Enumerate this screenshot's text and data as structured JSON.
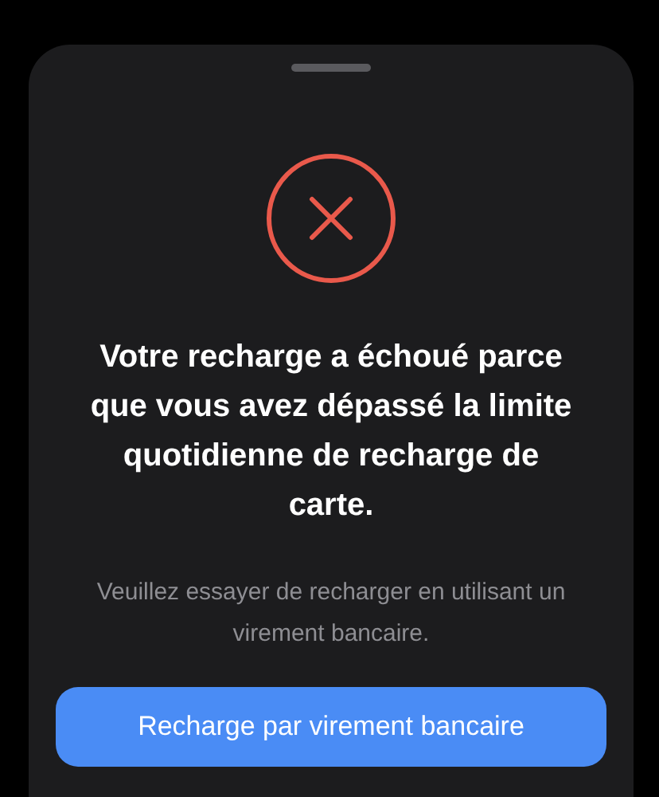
{
  "sheet": {
    "title": "Votre recharge a échoué parce que vous avez dépassé la limite quotidienne de recharge de carte.",
    "message": "Veuillez essayer de recharger en utilisant un virement bancaire.",
    "button": "Recharge par virement bancaire"
  }
}
